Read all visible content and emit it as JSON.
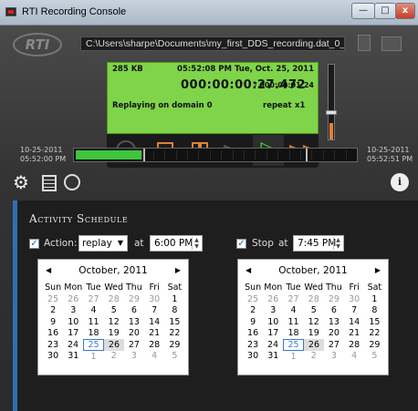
{
  "window": {
    "title": "RTI Recording Console",
    "min_label": "—",
    "max_label": "□",
    "close_label": "x"
  },
  "header": {
    "logo_text": "RTI",
    "file_path": "C:\\Users\\sharpe\\Documents\\my_first_DDS_recording.dat_0_0"
  },
  "lcd": {
    "size": "285 KB",
    "datetime": "05:52:08 PM  Tue, Oct. 25, 2011",
    "elapsed": "000:00:00:27.472",
    "total": "/ 000:00:01:24",
    "domain": "Replaying on domain 0",
    "repeat": "repeat",
    "speed": "x1"
  },
  "volume": {
    "level": 0.22
  },
  "timeline": {
    "start_date": "10-25-2011",
    "start_time": "05:52:00 PM",
    "end_date": "10-25-2011",
    "end_time": "05:52:51 PM",
    "progress": 0.33,
    "segment_count": 25
  },
  "schedule": {
    "title": "Activity Schedule",
    "action_label": "Action:",
    "action_value": "replay",
    "at_label": "at",
    "start_time": "6:00 PM",
    "stop_label": "Stop",
    "stop_at_label": "at",
    "stop_time": "7:45 PM",
    "start_checked": true,
    "stop_checked": true
  },
  "calendars": [
    {
      "month": "October, 2011",
      "days": [
        "Sun",
        "Mon",
        "Tue",
        "Wed",
        "Thu",
        "Fri",
        "Sat"
      ],
      "weeks": [
        [
          "25",
          "26",
          "27",
          "28",
          "29",
          "30",
          "1"
        ],
        [
          "2",
          "3",
          "4",
          "5",
          "6",
          "7",
          "8"
        ],
        [
          "9",
          "10",
          "11",
          "12",
          "13",
          "14",
          "15"
        ],
        [
          "16",
          "17",
          "18",
          "19",
          "20",
          "21",
          "22"
        ],
        [
          "23",
          "24",
          "25",
          "26",
          "27",
          "28",
          "29"
        ],
        [
          "30",
          "31",
          "1",
          "2",
          "3",
          "4",
          "5"
        ]
      ]
    },
    {
      "month": "October, 2011",
      "days": [
        "Sun",
        "Mon",
        "Tue",
        "Wed",
        "Thu",
        "Fri",
        "Sat"
      ],
      "weeks": [
        [
          "25",
          "26",
          "27",
          "28",
          "29",
          "30",
          "1"
        ],
        [
          "2",
          "3",
          "4",
          "5",
          "6",
          "7",
          "8"
        ],
        [
          "9",
          "10",
          "11",
          "12",
          "13",
          "14",
          "15"
        ],
        [
          "16",
          "17",
          "18",
          "19",
          "20",
          "21",
          "22"
        ],
        [
          "23",
          "24",
          "25",
          "26",
          "27",
          "28",
          "29"
        ],
        [
          "30",
          "31",
          "1",
          "2",
          "3",
          "4",
          "5"
        ]
      ]
    }
  ],
  "colors": {
    "accent": "#e0803a",
    "lcd": "#7fd44a",
    "play": "#3fd13a",
    "panel_edge": "#2f6fb5",
    "today": "#3b7ad0"
  }
}
